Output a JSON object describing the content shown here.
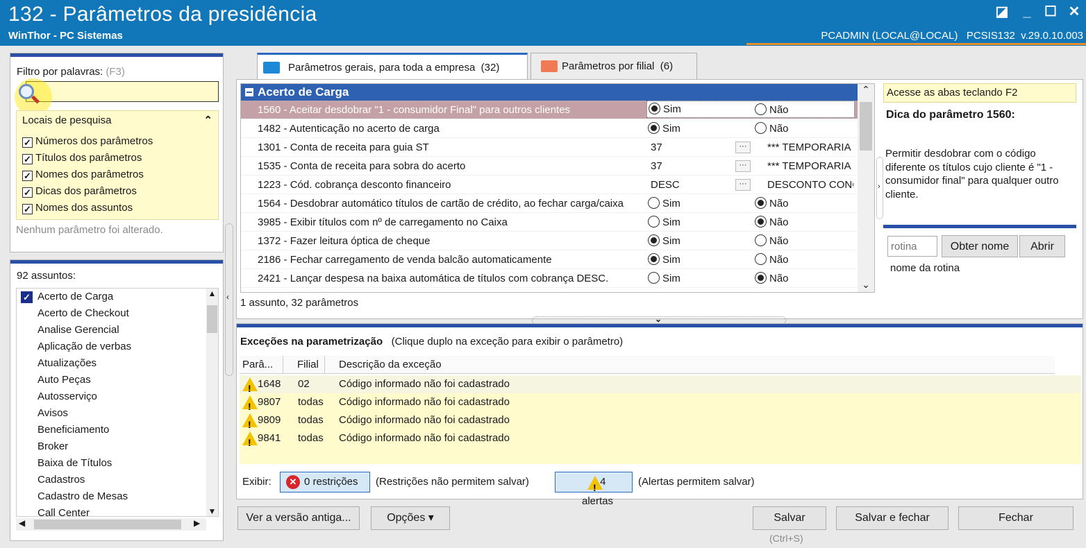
{
  "window": {
    "title": "132 - Parâmetros da presidência",
    "subtitle": "WinThor - PC Sistemas",
    "user_info": "PCADMIN (LOCAL@LOCAL)   PCSIS132  v.29.0.10.003"
  },
  "filter": {
    "label": "Filtro por palavras:",
    "shortcut": "(F3)",
    "value": "",
    "locations_title": "Locais de pesquisa",
    "options": [
      {
        "label": "Números dos parâmetros",
        "checked": true
      },
      {
        "label": "Títulos dos parâmetros",
        "checked": true
      },
      {
        "label": "Nomes dos parâmetros",
        "checked": true
      },
      {
        "label": "Dicas dos parâmetros",
        "checked": true
      },
      {
        "label": "Nomes dos assuntos",
        "checked": true
      }
    ],
    "status": "Nenhum parâmetro foi alterado."
  },
  "subjects": {
    "title": "92 assuntos:",
    "items": [
      "Acerto de Carga",
      "Acerto de Checkout",
      "Analise Gerencial",
      "Aplicação de verbas",
      "Atualizações",
      "Auto Peças",
      "Autosserviço",
      "Avisos",
      "Beneficiamento",
      "Broker",
      "Baixa de Títulos",
      "Cadastros",
      "Cadastro de Mesas",
      "Call Center"
    ],
    "selected_index": 0
  },
  "tabs": [
    {
      "label": "Parâmetros gerais, para toda a empresa",
      "count": "(32)",
      "active": true,
      "color": "#1e88d8"
    },
    {
      "label": "Parâmetros por filial",
      "count": "(6)",
      "active": false,
      "color": "#f07a56"
    }
  ],
  "grid": {
    "group": "Acerto de Carga",
    "summary": "1 assunto, 32 parâmetros",
    "rows": [
      {
        "name": "1560 - Aceitar desdobrar \"1 - consumidor Final\" para outros clientes",
        "type": "radio",
        "sim": true,
        "selected": true
      },
      {
        "name": "1482 - Autenticação no acerto de carga",
        "type": "radio",
        "sim": true
      },
      {
        "name": "1301 - Conta de receita para guia ST",
        "type": "lookup",
        "value": "37",
        "desc": "*** TEMPORARIA"
      },
      {
        "name": "1535 - Conta de receita para sobra do acerto",
        "type": "lookup",
        "value": "37",
        "desc": "*** TEMPORARIA"
      },
      {
        "name": "1223 - Cód. cobrança desconto financeiro",
        "type": "lookup",
        "value": "DESC",
        "desc": "DESCONTO CONCEDIDO"
      },
      {
        "name": "1564 - Desdobrar automático títulos de cartão de crédito, ao fechar carga/caixa",
        "type": "radio",
        "sim": false
      },
      {
        "name": "3985 - Exibir títulos com nº de carregamento no Caixa",
        "type": "radio",
        "sim": false
      },
      {
        "name": "1372 - Fazer leitura óptica de cheque",
        "type": "radio",
        "sim": true
      },
      {
        "name": "2186 - Fechar carregamento de venda balcão automaticamente",
        "type": "radio",
        "sim": true
      },
      {
        "name": "2421 - Lançar despesa na baixa automática de títulos com cobrança DESC.",
        "type": "radio",
        "sim": false
      }
    ],
    "sim_label": "Sim",
    "nao_label": "Não"
  },
  "hint": {
    "tip": "Acesse as abas teclando F2",
    "title": "Dica do parâmetro 1560:",
    "text": "Permitir desdobrar com o código diferente os títulos cujo cliente é \"1 - consumidor final\" para qualquer outro cliente.",
    "routine_placeholder": "rotina",
    "get_name_button": "Obter nome",
    "open_button": "Abrir",
    "routine_name": "nome da rotina"
  },
  "exceptions": {
    "title": "Exceções na parametrização",
    "subtitle": "(Clique duplo na exceção para exibir o parâmetro)",
    "columns": [
      "Parâ...",
      "Filial",
      "Descrição da exceção"
    ],
    "rows": [
      {
        "param": "1648",
        "filial": "02",
        "desc": "Código informado não foi cadastrado"
      },
      {
        "param": "9807",
        "filial": "todas",
        "desc": "Código informado não foi cadastrado"
      },
      {
        "param": "9809",
        "filial": "todas",
        "desc": "Código informado não foi cadastrado"
      },
      {
        "param": "9841",
        "filial": "todas",
        "desc": "Código informado não foi cadastrado"
      }
    ],
    "show_label": "Exibir:",
    "restrictions_button": "0 restrições",
    "restrictions_note": "(Restrições não permitem salvar)",
    "alerts_button": "4 alertas",
    "alerts_note": "(Alertas permitem salvar)"
  },
  "footer": {
    "old_version": "Ver a versão antiga...",
    "options": "Opções ▾",
    "save": "Salvar",
    "save_shortcut": "(Ctrl+S)",
    "save_close": "Salvar e fechar",
    "close": "Fechar"
  }
}
